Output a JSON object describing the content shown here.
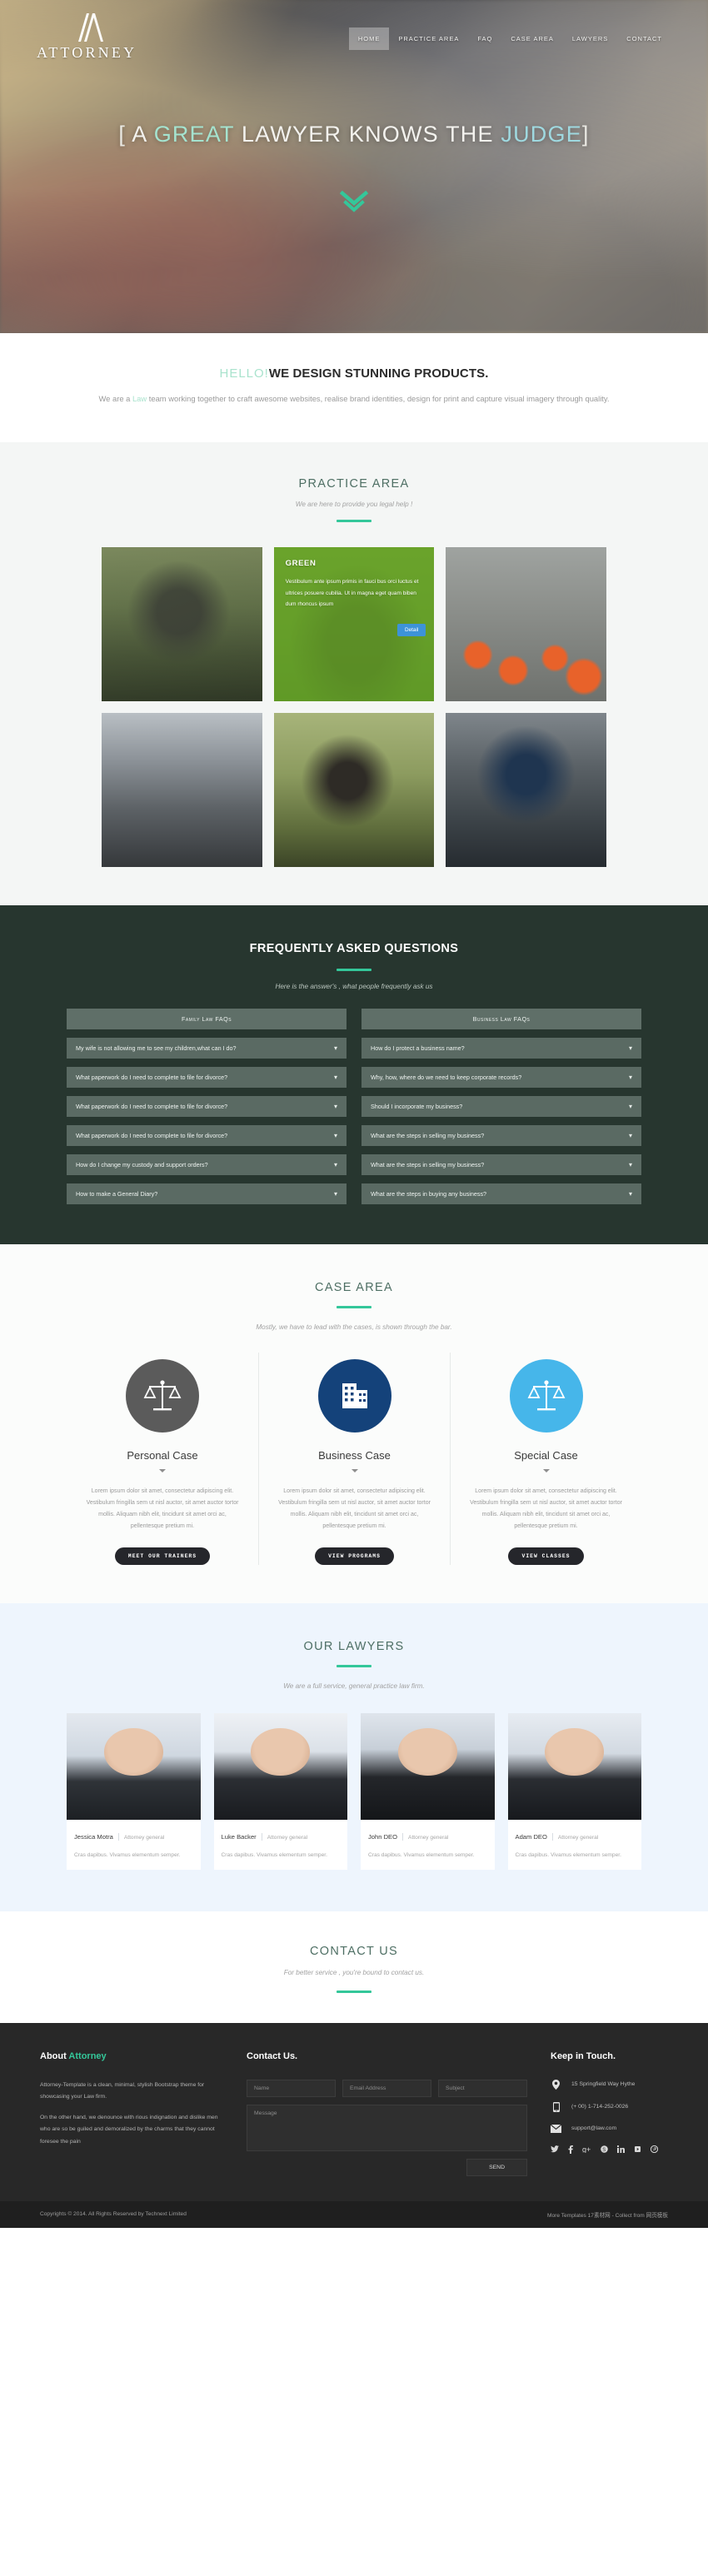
{
  "hero": {
    "logo_text": "ATTORNEY",
    "nav": [
      {
        "label": "HOME",
        "active": true
      },
      {
        "label": "PRACTICE AREA",
        "active": false
      },
      {
        "label": "FAQ",
        "active": false
      },
      {
        "label": "CASE AREA",
        "active": false
      },
      {
        "label": "LAWYERS",
        "active": false
      },
      {
        "label": "CONTACT",
        "active": false
      }
    ],
    "title_parts": {
      "open_bracket": "[",
      "a": "A",
      "great": "GREAT",
      "lawyer_knows_the": "LAWYER KNOWS THE",
      "judge": "JUDGE",
      "close_bracket": "]"
    },
    "scroll_icon": "chevron-double-down"
  },
  "intro": {
    "hello": "HELLO!",
    "heading": "WE DESIGN STUNNING PRODUCTS.",
    "body_pre": "We are a ",
    "body_accent": "Law",
    "body_post": " team working together to craft awesome websites, realise brand identities, design for print and capture visual imagery through quality."
  },
  "practice": {
    "title": "PRACTICE AREA",
    "subtitle": "We are here to provide you legal help !",
    "tiles": [
      {
        "id": "tile-1",
        "hover": false,
        "title": "",
        "text": "",
        "button": ""
      },
      {
        "id": "tile-2",
        "hover": true,
        "title": "GREEN",
        "text": "Vestibulum ante ipsum primis in fauci bus orci luctus et ultrices posuere cubilia. Ut in magna eget quam biben dum rhoncus ipsum",
        "button": "Detail"
      },
      {
        "id": "tile-3",
        "hover": false,
        "title": "",
        "text": "",
        "button": ""
      },
      {
        "id": "tile-4",
        "hover": false,
        "title": "",
        "text": "",
        "button": ""
      },
      {
        "id": "tile-5",
        "hover": false,
        "title": "",
        "text": "",
        "button": ""
      },
      {
        "id": "tile-6",
        "hover": false,
        "title": "",
        "text": "",
        "button": ""
      }
    ]
  },
  "faq": {
    "title": "FREQUENTLY ASKED QUESTIONS",
    "subtitle": "Here is the answer's , what people frequently ask us",
    "left_header": "Family Law FAQs",
    "right_header": "Business Law FAQs",
    "left_items": [
      "My wife is not allowing me to see my children,what can I do?",
      "What paperwork do I need to complete to file for divorce?",
      "What paperwork do I need to complete to file for divorce?",
      "What paperwork do I need to complete to file for divorce?",
      "How do I change my custody and support orders?",
      "How to make a General Diary?"
    ],
    "right_items": [
      "How do I protect a business name?",
      "Why, how, where do we need to keep corporate records?",
      "Should I incorporate my business?",
      "What are the steps in selling my business?",
      "What are the steps in selling my business?",
      "What are the steps in buying any business?"
    ],
    "chevron": "⌄"
  },
  "case": {
    "title": "CASE AREA",
    "subtitle": "Mostly, we have to lead with the cases, is shown through the bar.",
    "cards": [
      {
        "title": "Personal Case",
        "icon": "scales-of-justice-icon",
        "icon_color": "#5b5b5b",
        "text": "Lorem ipsum dolor sit amet, consectetur adipiscing elit. Vestibulum fringilla sem ut nisl auctor, sit amet auctor tortor mollis. Aliquam nibh elit, tincidunt sit amet orci ac, pellentesque pretium mi.",
        "button": "MEET OUR TRAINERS"
      },
      {
        "title": "Business Case",
        "icon": "office-building-icon",
        "icon_color": "#14427a",
        "text": "Lorem ipsum dolor sit amet, consectetur adipiscing elit. Vestibulum fringilla sem ut nisl auctor, sit amet auctor tortor mollis. Aliquam nibh elit, tincidunt sit amet orci ac, pellentesque pretium mi.",
        "button": "VIEW PROGRAMS"
      },
      {
        "title": "Special Case",
        "icon": "scales-of-justice-icon",
        "icon_color": "#46b6ea",
        "text": "Lorem ipsum dolor sit amet, consectetur adipiscing elit. Vestibulum fringilla sem ut nisl auctor, sit amet auctor tortor mollis. Aliquam nibh elit, tincidunt sit amet orci ac, pellentesque pretium mi.",
        "button": "VIEW CLASSES"
      }
    ]
  },
  "lawyers": {
    "title": "OUR LAWYERS",
    "subtitle": "We are a full service, general practice law firm.",
    "members": [
      {
        "name": "Jessica Motra",
        "role": "Attorney general",
        "desc": "Cras dapibus. Vivamus elementum semper."
      },
      {
        "name": "Luke Backer",
        "role": "Attorney general",
        "desc": "Cras dapibus. Vivamus elementum semper."
      },
      {
        "name": "John DEO",
        "role": "Attorney general",
        "desc": "Cras dapibus. Vivamus elementum semper."
      },
      {
        "name": "Adam DEO",
        "role": "Attorney general",
        "desc": "Cras dapibus. Vivamus elementum semper."
      }
    ]
  },
  "contact_head": {
    "title": "CONTACT US",
    "subtitle": "For better service , you're bound to contact us."
  },
  "footer": {
    "about": {
      "heading_main": "About ",
      "heading_accent": "Attorney",
      "p1": "Attorney-Template is a clean, minimal, stylish Bootstrap theme for showcasing your Law firm.",
      "p2": "On the other hand, we denounce with rious indignation and dislike men who are so be guiled and demoralized by the charms that they cannot foresee the pain"
    },
    "contact_form": {
      "heading": "Contact Us.",
      "name_placeholder": "Name",
      "email_placeholder": "Email Address",
      "subject_placeholder": "Subject",
      "message_placeholder": "Message",
      "send_label": "SEND"
    },
    "keep_in_touch": {
      "heading": "Keep in Touch.",
      "address": "15 Springfield Way Hythe",
      "phone": "(+ 00) 1-714-252-0026",
      "email": "support@law.com",
      "socials": [
        "twitter-icon",
        "facebook-icon",
        "google-plus-icon",
        "skype-icon",
        "linkedin-icon",
        "youtube-icon",
        "pinterest-icon"
      ]
    }
  },
  "copyright": {
    "left": "Copyrights © 2014. All Rights Reserved by Technext Limited",
    "right": "More Templates 17素材网 - Collect from 网页模板"
  },
  "colors": {
    "accent_green": "#34c79a",
    "accent_mint": "#a9e3cd",
    "faq_bg": "#27362f",
    "footer_bg": "#282828",
    "lawyers_bg": "#eef5fd"
  }
}
